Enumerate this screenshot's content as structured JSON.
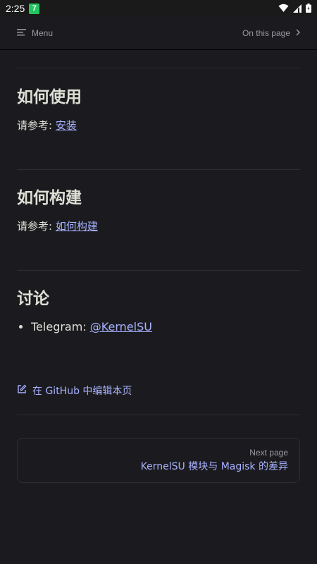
{
  "status_bar": {
    "time": "2:25",
    "badge": "7"
  },
  "navbar": {
    "menu_label": "Menu",
    "on_this_page_label": "On this page"
  },
  "sections": [
    {
      "title": "如何使用",
      "prefix": "请参考: ",
      "link_text": "安装"
    },
    {
      "title": "如何构建",
      "prefix": "请参考: ",
      "link_text": "如何构建"
    },
    {
      "title": "讨论",
      "list": [
        {
          "prefix": "Telegram: ",
          "link_text": "@KernelSU"
        }
      ]
    }
  ],
  "edit_link": "在 GitHub 中编辑本页",
  "next_page": {
    "label": "Next page",
    "title": "KernelSU 模块与 Magisk 的差异"
  },
  "colors": {
    "background": "#1b1b1f",
    "text": "#dfdfd6",
    "link": "#a8b1ff",
    "muted": "#98989f",
    "divider": "#2e2e32",
    "badge": "#22c55e"
  }
}
